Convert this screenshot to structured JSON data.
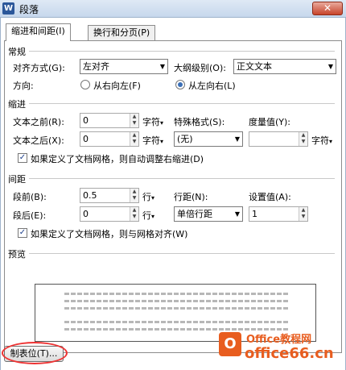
{
  "window": {
    "title": "段落",
    "app_icon": "W",
    "close_symbol": "✕"
  },
  "tabs": [
    {
      "label": "缩进和间距(I)"
    },
    {
      "label": "换行和分页(P)"
    }
  ],
  "general": {
    "heading": "常规",
    "alignment_label": "对齐方式(G):",
    "alignment_value": "左对齐",
    "outline_label": "大纲级别(O):",
    "outline_value": "正文文本",
    "direction_label": "方向:",
    "rtl_label": "从右向左(F)",
    "ltr_label": "从左向右(L)",
    "selected_direction": "ltr"
  },
  "indent": {
    "heading": "缩进",
    "before_label": "文本之前(R):",
    "before_value": "0",
    "before_unit": "字符",
    "after_label": "文本之后(X):",
    "after_value": "0",
    "after_unit": "字符",
    "special_label": "特殊格式(S):",
    "special_value": "(无)",
    "measure_label": "度量值(Y):",
    "measure_value": "",
    "measure_unit": "字符",
    "auto_adjust_label": "如果定义了文档网格，则自动调整右缩进(D)",
    "auto_adjust_checked": true
  },
  "spacing": {
    "heading": "间距",
    "before_label": "段前(B):",
    "before_value": "0.5",
    "before_unit": "行",
    "after_label": "段后(E):",
    "after_value": "0",
    "after_unit": "行",
    "line_label": "行距(N):",
    "line_value": "单倍行距",
    "setting_label": "设置值(A):",
    "setting_value": "1",
    "grid_align_label": "如果定义了文档网格，则与网格对齐(W)",
    "grid_align_checked": true
  },
  "preview": {
    "heading": "预览"
  },
  "buttons": {
    "tabs_label": "制表位(T)..."
  },
  "watermark": {
    "site_name": "Office教程网",
    "site_url": "office66.cn"
  },
  "colors": {
    "accent": "#3b6fb6",
    "highlight_circle": "#ee3333",
    "logo": "#e85d1f"
  }
}
